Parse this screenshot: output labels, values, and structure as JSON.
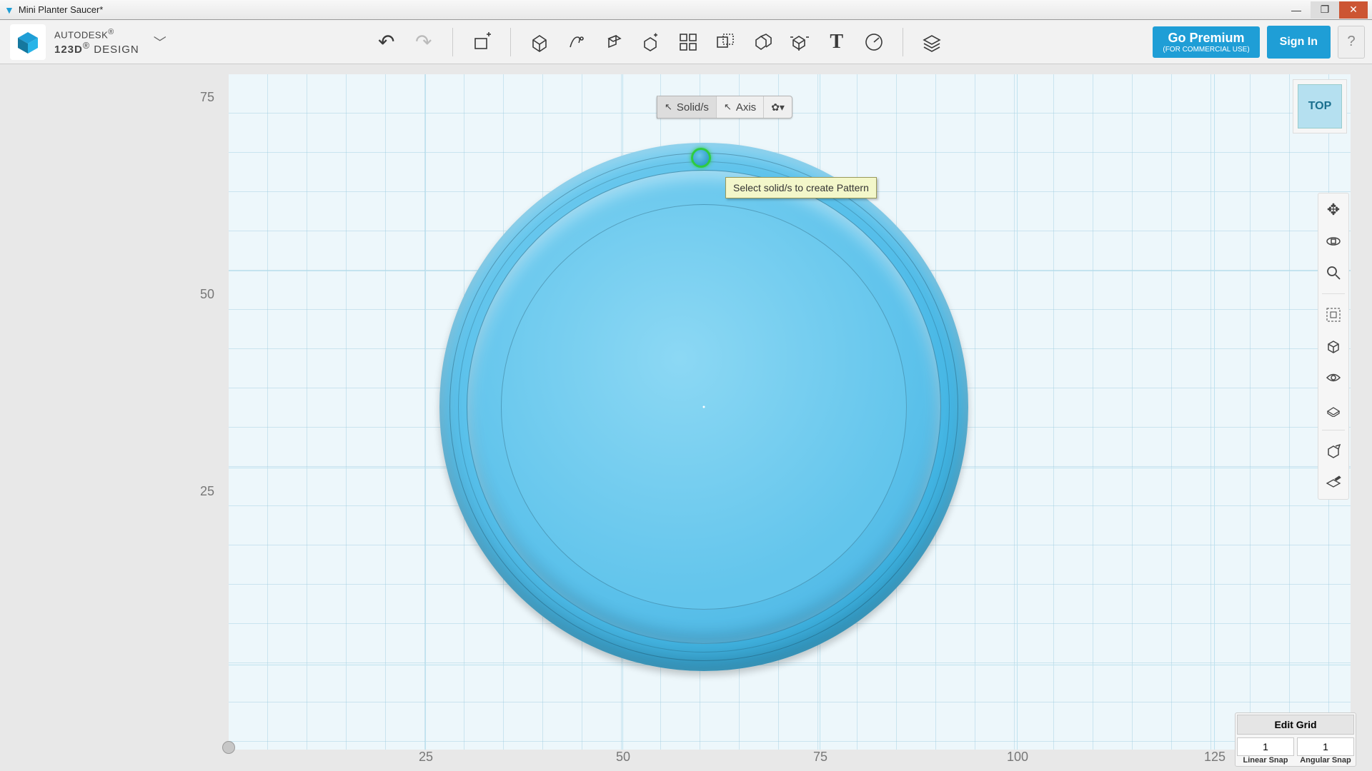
{
  "window": {
    "title": "Mini Planter Saucer*"
  },
  "brand": {
    "company": "AUTODESK",
    "reg": "®",
    "product": "123D",
    "product_reg": "®",
    "suffix": "DESIGN"
  },
  "topbar": {
    "premium": "Go Premium",
    "premium_sub": "(FOR COMMERCIAL USE)",
    "signin": "Sign In",
    "help": "?"
  },
  "context": {
    "solids": "Solid/s",
    "axis": "Axis"
  },
  "tooltip": "Select solid/s to create Pattern",
  "viewcube": "TOP",
  "ruler": {
    "y": [
      "75",
      "50",
      "25"
    ],
    "x": [
      "25",
      "50",
      "75",
      "100",
      "125"
    ]
  },
  "gridctl": {
    "title": "Edit Grid",
    "linear": "1",
    "angular": "1",
    "linear_lbl": "Linear Snap",
    "angular_lbl": "Angular Snap"
  }
}
